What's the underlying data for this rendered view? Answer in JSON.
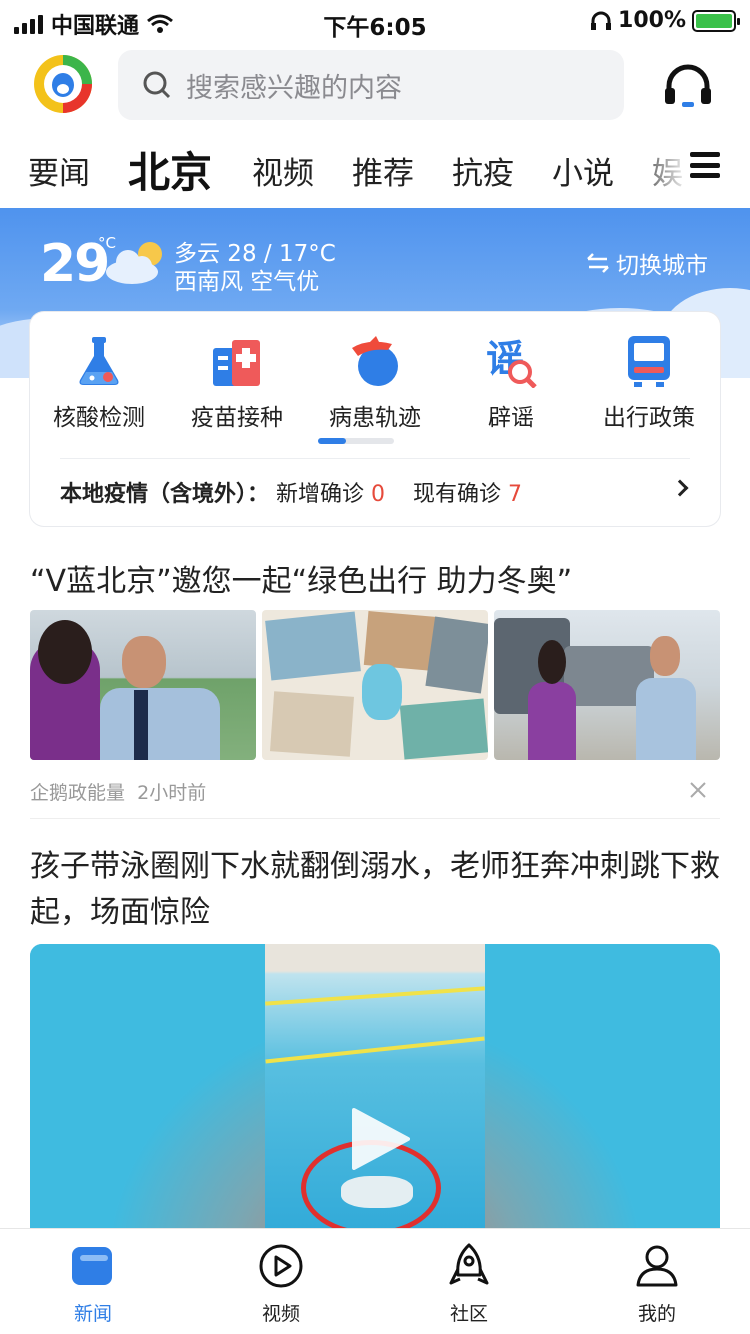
{
  "status_bar": {
    "carrier": "中国联通",
    "time": "下午6:05",
    "battery": "100%"
  },
  "search": {
    "placeholder": "搜索感兴趣的内容"
  },
  "channels": [
    {
      "label": "要闻"
    },
    {
      "label": "北京",
      "active": true
    },
    {
      "label": "视频"
    },
    {
      "label": "推荐"
    },
    {
      "label": "抗疫"
    },
    {
      "label": "小说"
    },
    {
      "label": "娱"
    }
  ],
  "weather": {
    "temp": "29",
    "deg": "°C",
    "desc": "多云 28 / 17°C",
    "wind": "西南风 空气优",
    "switch": "切换城市"
  },
  "services": [
    {
      "label": "核酸检测",
      "icon": "flask-icon"
    },
    {
      "label": "疫苗接种",
      "icon": "hospital-icon"
    },
    {
      "label": "病患轨迹",
      "icon": "plane-icon"
    },
    {
      "label": "辟谣",
      "icon": "rumor-icon"
    },
    {
      "label": "出行政策",
      "icon": "train-icon"
    }
  ],
  "epidemic": {
    "label": "本地疫情（含境外）：",
    "new_label": "新增确诊",
    "new_value": "0",
    "current_label": "现有确诊",
    "current_value": "7"
  },
  "articles": [
    {
      "title": "“V蓝北京”邀您一起“绿色出行 助力冬奥”",
      "source": "企鹅政能量",
      "time": "2小时前"
    },
    {
      "title": "孩子带泳圈刚下水就翻倒溺水，老师狂奔冲刺跳下救起，场面惊险"
    }
  ],
  "bottom_nav": [
    {
      "label": "新闻",
      "active": true,
      "icon": "news-icon"
    },
    {
      "label": "视频",
      "icon": "play-icon"
    },
    {
      "label": "社区",
      "icon": "rocket-icon"
    },
    {
      "label": "我的",
      "icon": "person-icon"
    }
  ],
  "colors": {
    "accent": "#2f7ee6",
    "alert": "#e64a3b"
  }
}
